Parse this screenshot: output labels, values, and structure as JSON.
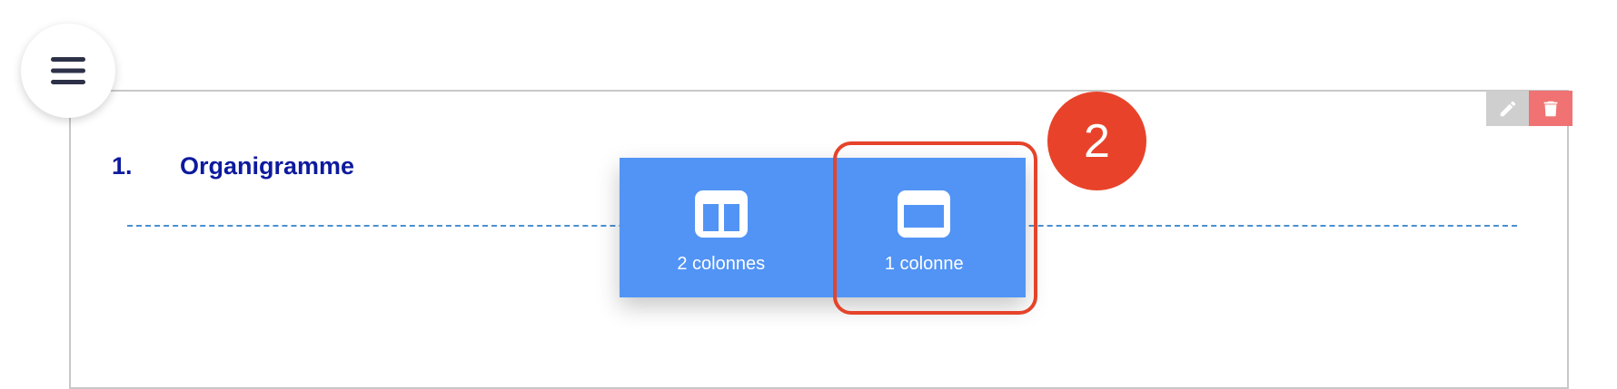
{
  "menu": {
    "icon": "hamburger-menu-icon"
  },
  "section": {
    "number": "1.",
    "title": "Organigramme",
    "title_color": "#0d1a9e"
  },
  "toolbar": {
    "edit_icon": "pencil-icon",
    "delete_icon": "trash-icon",
    "delete_color": "#f07272"
  },
  "layout_picker": {
    "background": "#5294f5",
    "options": [
      {
        "label": "2 colonnes",
        "icon": "two-columns-icon"
      },
      {
        "label": "1 colonne",
        "icon": "one-column-icon"
      }
    ]
  },
  "annotation": {
    "step_number": "2",
    "color": "#e5432a"
  }
}
